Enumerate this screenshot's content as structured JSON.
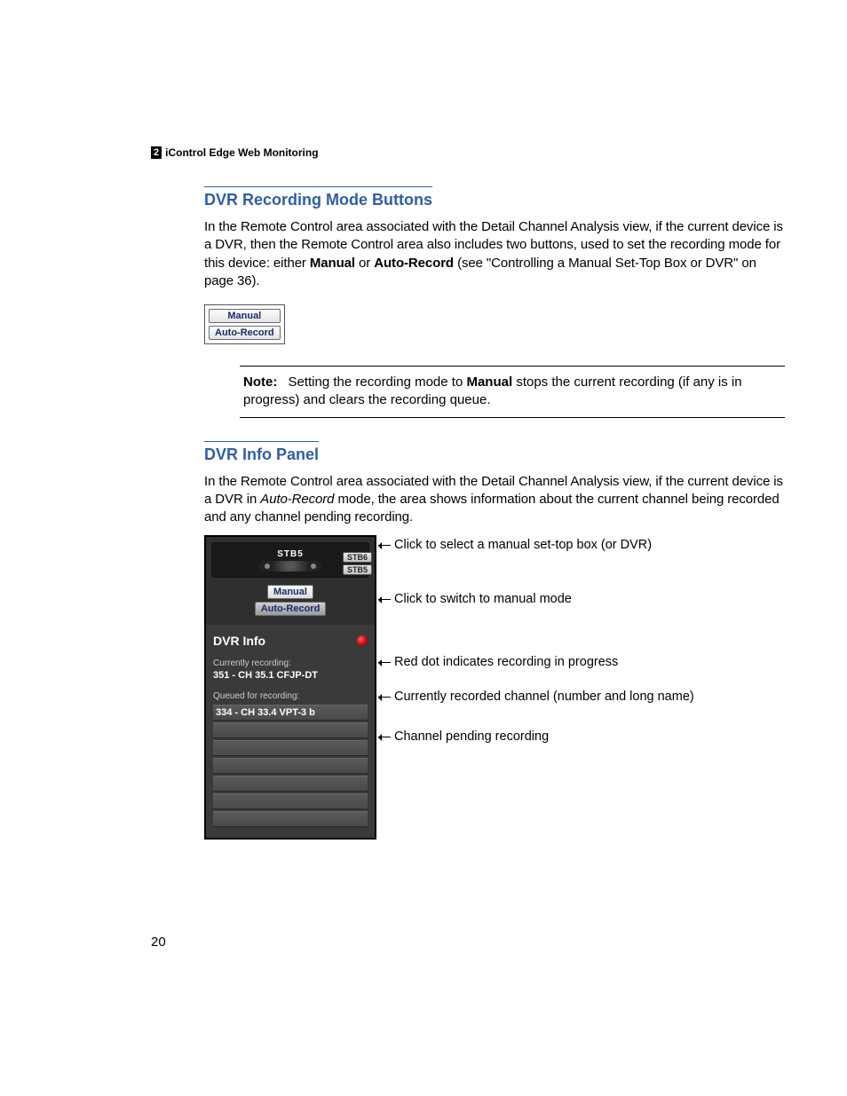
{
  "header": {
    "chapter_num": "2",
    "chapter_title": "iControl Edge Web Monitoring"
  },
  "section1": {
    "title": "DVR Recording Mode Buttons",
    "p1a": "In the Remote Control area associated with the Detail Channel Analysis view, if the current device is a DVR, then the Remote Control area also includes two buttons, used to set the recording mode for this device: either ",
    "bold_manual": "Manual",
    "p1b": " or ",
    "bold_auto": "Auto-Record",
    "p1c": " (see \"Controlling a Manual Set-Top Box or DVR\" on page 36).",
    "btn_manual": "Manual",
    "btn_auto": "Auto-Record",
    "note_label": "Note:",
    "note_a": "Setting the recording mode to ",
    "note_bold": "Manual",
    "note_b": " stops the current recording (if any is in progress) and clears the recording queue."
  },
  "section2": {
    "title": "DVR Info Panel",
    "p1a": "In the Remote Control area associated with the Detail Channel Analysis view, if the current device is a DVR in ",
    "italic": "Auto-Record",
    "p1b": " mode, the area shows information about the current channel being recorded and any channel pending recording."
  },
  "panel": {
    "stb_selected": "STB5",
    "stb_options": [
      "STB6",
      "STB5"
    ],
    "btn_manual": "Manual",
    "btn_auto": "Auto-Record",
    "title": "DVR Info",
    "currently_label": "Currently recording:",
    "currently_value": "351 - CH 35.1 CFJP-DT",
    "queued_label": "Queued for recording:",
    "queued": [
      "334 - CH 33.4 VPT-3 b",
      "",
      "",
      "",
      "",
      "",
      ""
    ]
  },
  "callouts": {
    "c1": "Click to select a manual set-top box (or DVR)",
    "c2": "Click to switch to manual mode",
    "c3": "Red dot indicates recording in progress",
    "c4": "Currently recorded channel (number and long name)",
    "c5": "Channel pending recording"
  },
  "page_number": "20"
}
